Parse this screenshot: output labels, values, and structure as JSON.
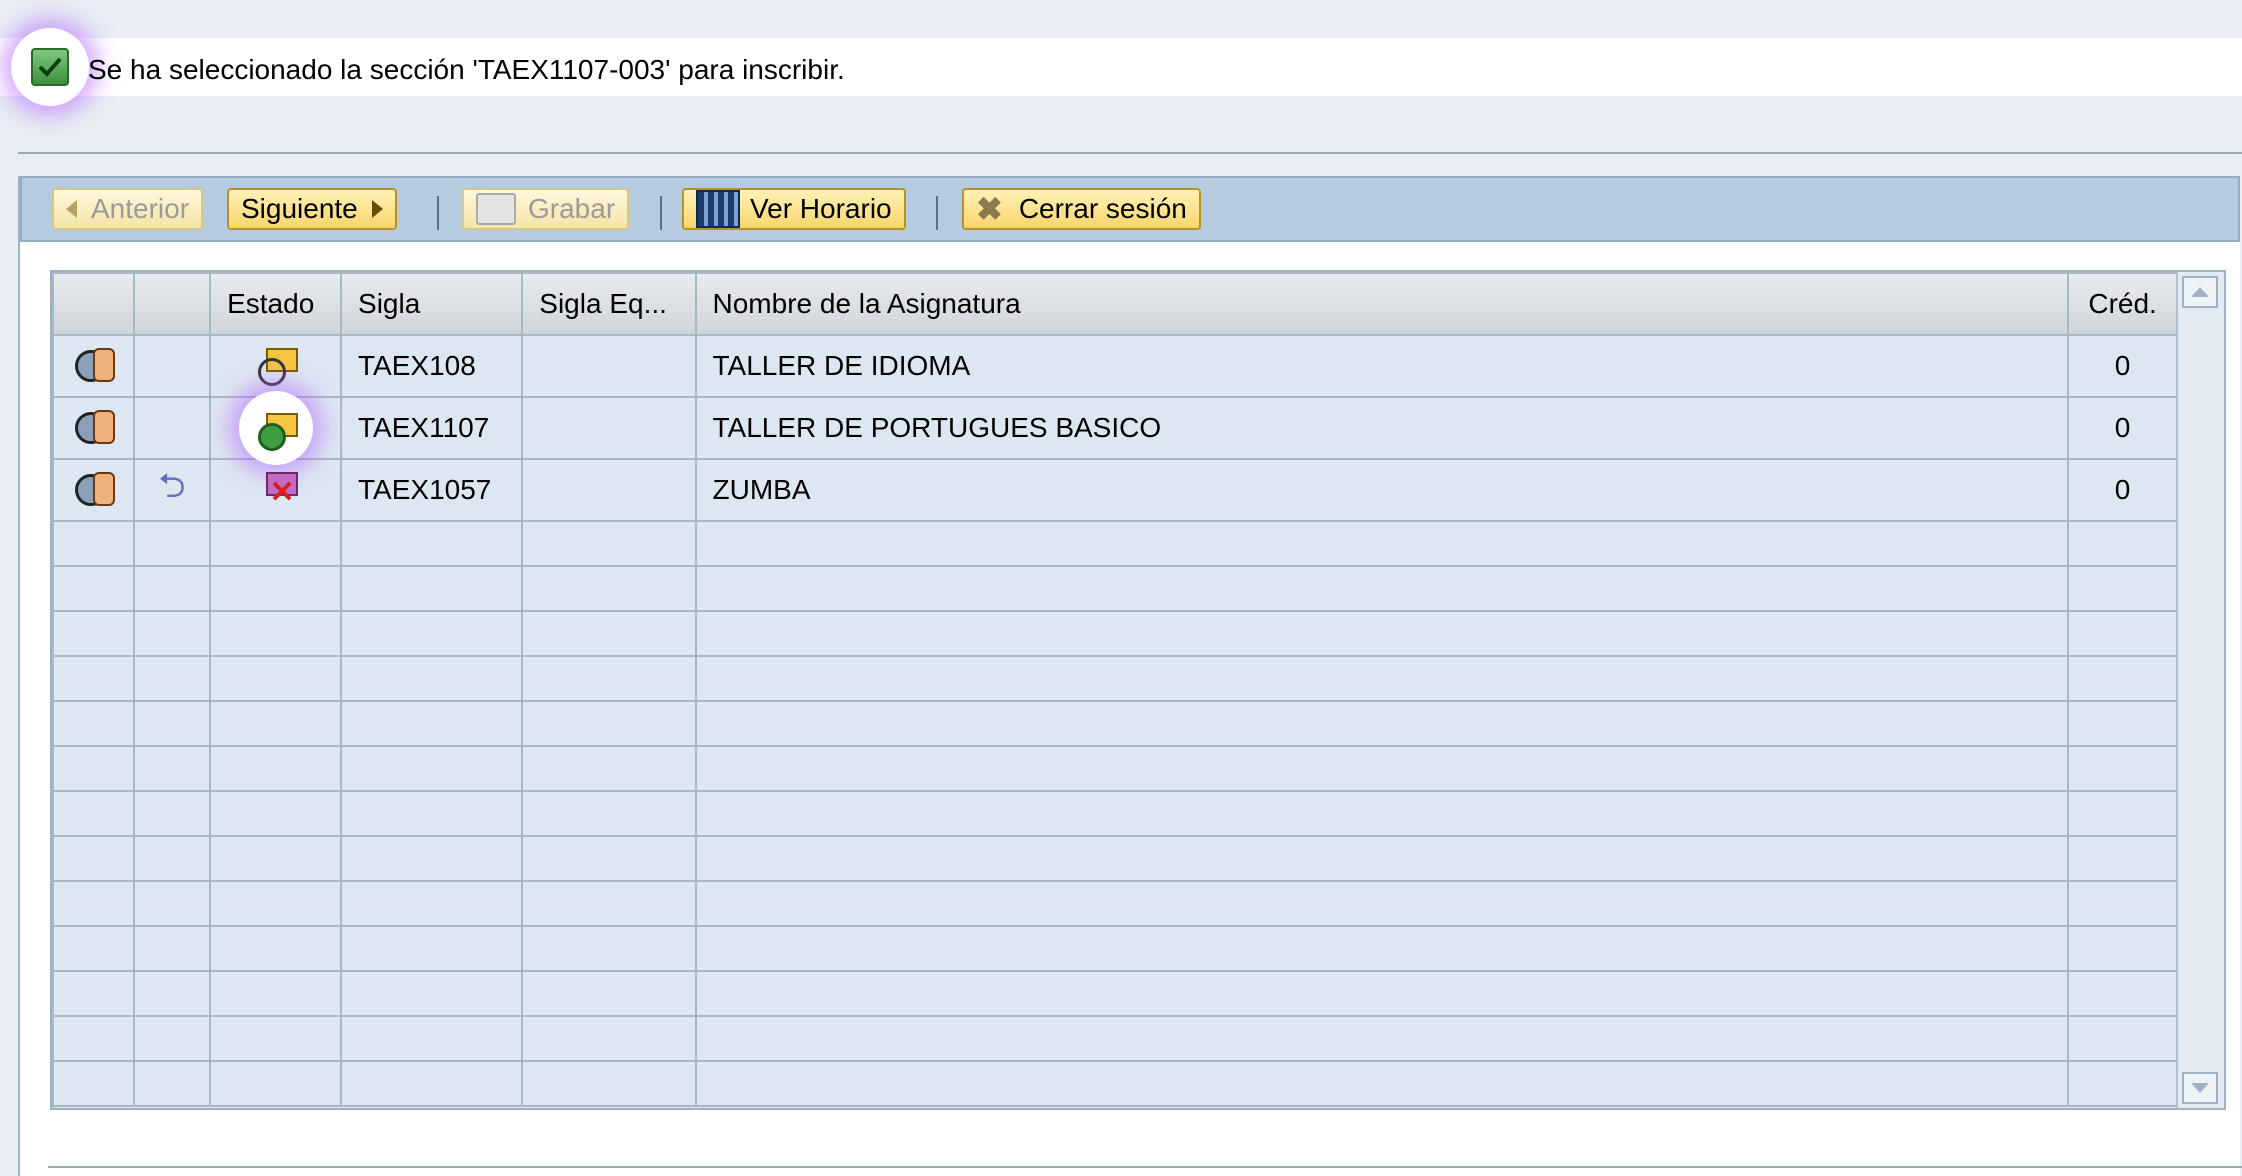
{
  "message": {
    "text": "Se ha seleccionado la sección 'TAEX1107-003' para inscribir.",
    "icon": "checkbox-checked-icon"
  },
  "toolbar": {
    "previous_label": "Anterior",
    "next_label": "Siguiente",
    "save_label": "Grabar",
    "schedule_label": "Ver Horario",
    "logout_label": "Cerrar sesión"
  },
  "table": {
    "columns": [
      "",
      "",
      "Estado",
      "Sigla",
      "Sigla Eq...",
      "Nombre de la Asignatura",
      "Créd."
    ],
    "rows": [
      {
        "status": "pending",
        "code": "TAEX108",
        "equiv": "",
        "name": "TALLER DE IDIOMA",
        "credits": "0"
      },
      {
        "status": "selected",
        "code": "TAEX1107",
        "equiv": "",
        "name": "TALLER DE PORTUGUES BASICO",
        "credits": "0"
      },
      {
        "status": "rejected",
        "code": "TAEX1057",
        "equiv": "",
        "name": "ZUMBA",
        "credits": "0"
      }
    ]
  },
  "colors": {
    "accent_highlight": "#b266ff",
    "toolbar_bg": "#b5cbe0",
    "button_bg": "#f7d66a"
  }
}
